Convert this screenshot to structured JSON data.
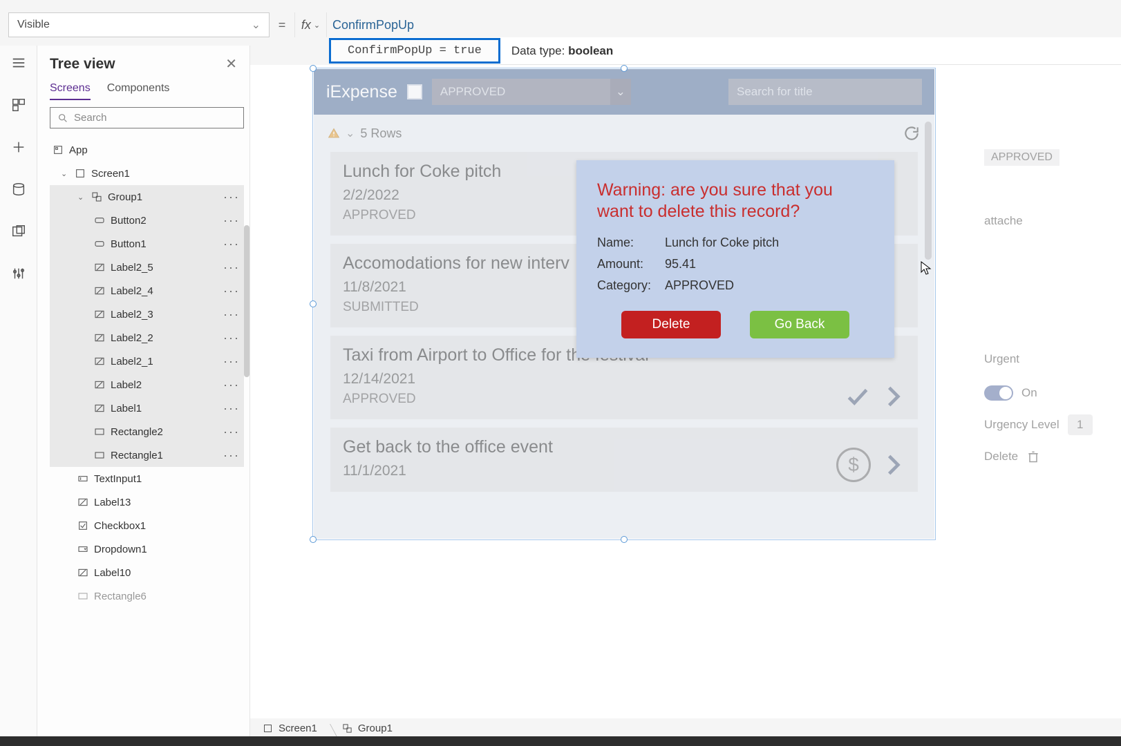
{
  "property_selector": {
    "value": "Visible"
  },
  "formula": {
    "text": "ConfirmPopUp",
    "evaluated": "ConfirmPopUp = true",
    "data_type_label": "Data type: ",
    "data_type_value": "boolean"
  },
  "tree_view": {
    "title": "Tree view",
    "tabs": {
      "screens": "Screens",
      "components": "Components"
    },
    "search_placeholder": "Search",
    "root": "App",
    "screen": "Screen1",
    "group": "Group1",
    "items": [
      "Button2",
      "Button1",
      "Label2_5",
      "Label2_4",
      "Label2_3",
      "Label2_2",
      "Label2_1",
      "Label2",
      "Label1",
      "Rectangle2",
      "Rectangle1"
    ],
    "extra": [
      "TextInput1",
      "Label13",
      "Checkbox1",
      "Dropdown1",
      "Label10",
      "Rectangle6"
    ]
  },
  "app": {
    "title": "iExpense",
    "dropdown_value": "APPROVED",
    "search_placeholder": "Search for title",
    "row_count": "5 Rows",
    "approved_tag": "APPROVED",
    "records": [
      {
        "title": "Lunch for Coke pitch",
        "date": "2/2/2022",
        "status": "APPROVED"
      },
      {
        "title": "Accomodations for new interv",
        "date": "11/8/2021",
        "status": "SUBMITTED"
      },
      {
        "title": "Taxi from Airport to Office for the festival",
        "date": "12/14/2021",
        "status": "APPROVED"
      },
      {
        "title": "Get back to the office event",
        "date": "11/1/2021",
        "status": ""
      }
    ]
  },
  "popup": {
    "warning": "Warning: are you sure that you want to delete this record?",
    "name_k": "Name:",
    "name_v": "Lunch for Coke pitch",
    "amount_k": "Amount:",
    "amount_v": "95.41",
    "cat_k": "Category:",
    "cat_v": "APPROVED",
    "delete": "Delete",
    "goback": "Go Back"
  },
  "right_props": {
    "attachments": "attache",
    "urgent_label": "Urgent",
    "urgent_state": "On",
    "urgency_label": "Urgency Level",
    "urgency_value": "1",
    "delete_label": "Delete"
  },
  "breadcrumb": {
    "screen": "Screen1",
    "group": "Group1"
  }
}
